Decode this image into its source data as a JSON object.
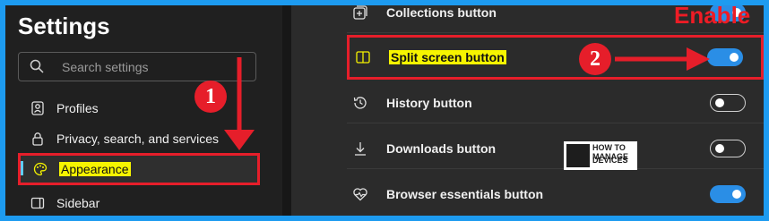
{
  "settings": {
    "title": "Settings",
    "search_placeholder": "Search settings",
    "nav": [
      {
        "label": "Profiles",
        "icon": "profiles-icon"
      },
      {
        "label": "Privacy, search, and services",
        "icon": "lock-icon"
      },
      {
        "label": "Appearance",
        "icon": "appearance-icon",
        "selected": true
      },
      {
        "label": "Sidebar",
        "icon": "sidebar-icon"
      }
    ]
  },
  "toolbar_buttons": [
    {
      "label": "Collections button",
      "icon": "collections-icon",
      "enabled": true
    },
    {
      "label": "Split screen button",
      "icon": "split-screen-icon",
      "enabled": true
    },
    {
      "label": "History button",
      "icon": "history-icon",
      "enabled": false
    },
    {
      "label": "Downloads button",
      "icon": "download-icon",
      "enabled": false
    },
    {
      "label": "Browser essentials button",
      "icon": "heart-pulse-icon",
      "enabled": true
    }
  ],
  "annotations": {
    "enable_text": "Enable",
    "step1": "1",
    "step2": "2",
    "accent_color": "#e61e2a",
    "highlight_color": "#f6f400"
  },
  "logo": {
    "line1": "HOW TO MANAGE",
    "line2": "DEVICES"
  }
}
